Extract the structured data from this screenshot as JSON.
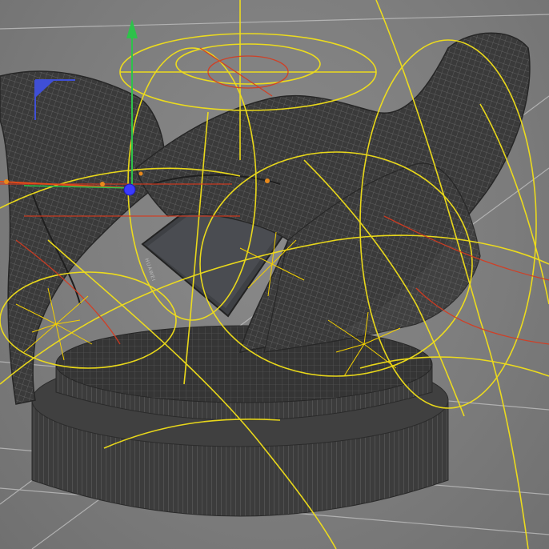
{
  "viewport": {
    "background": "#7e7e7e",
    "wire_color": "#5c5c5c",
    "guide_color": "#f2e019",
    "guide_color_red": "#d83a1e",
    "gizmo": {
      "y_axis_color": "#2ec24a",
      "x_axis_color": "#e24a1a",
      "z_axis_color": "#3f4fd6",
      "handle_color": "#3a3aff"
    }
  },
  "scene": {
    "objects": [
      "cloth-mesh",
      "phone",
      "pedestal-cylinder"
    ],
    "phone": {
      "brand_label": "HUAWEI",
      "color": "#3e4044"
    }
  }
}
